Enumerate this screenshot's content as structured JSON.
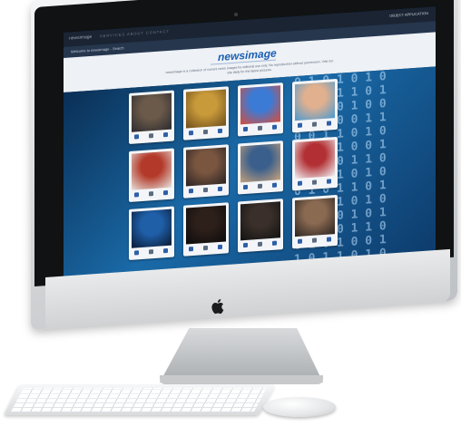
{
  "screen": {
    "topbar": {
      "brand": "newsimage",
      "nav": "SERVICES   ABOUT   CONTACT",
      "right_link": "OBJECT APPLICATION"
    },
    "breadcrumb": "Welcome to newsimage - Search",
    "hero": {
      "logo": "newsimage",
      "tagline": "newsimage is a collection of current news images for editorial use only. No reproduction without permission. Visit our site daily for the latest pictures."
    },
    "binary_pattern": "0 1 0 1 0 1 0\n1 0 0 1 1 0 1\n0 1 1 0 1 0 0\n1 0 1 0 0 1 1\n0 0 1 1 0 1 0\n1 1 0 1 0 0 1\n0 1 0 0 1 1 0\n1 0 1 1 0 1 0\n0 1 0 1 1 0 1\n1 0 0 1 0 1 0\n0 1 1 0 1 0 1\n1 0 1 0 1 1 0\n0 1 0 1 0 0 1\n1 0 1 1 0 1 0",
    "cards": [
      {
        "subject": "man-portrait",
        "color1": "#6b5a4a",
        "color2": "#2c2a2e"
      },
      {
        "subject": "bitcoin-coins",
        "color1": "#c99a3a",
        "color2": "#6e4e1b"
      },
      {
        "subject": "app-icons-phone",
        "color1": "#3b7bd6",
        "color2": "#d94c3a"
      },
      {
        "subject": "smiling-man",
        "color1": "#e1b08f",
        "color2": "#4a9ad0"
      },
      {
        "subject": "game-character",
        "color1": "#b33a2a",
        "color2": "#e6e2dc"
      },
      {
        "subject": "woman-portrait",
        "color1": "#7a5640",
        "color2": "#2a2222"
      },
      {
        "subject": "group-meeting",
        "color1": "#3a5f8c",
        "color2": "#c6a17a"
      },
      {
        "subject": "politician-speech",
        "color1": "#b23033",
        "color2": "#f0f2f5"
      },
      {
        "subject": "earth-from-space",
        "color1": "#1f5fa8",
        "color2": "#0b1a33"
      },
      {
        "subject": "dark-scene",
        "color1": "#2d1f1a",
        "color2": "#0b0b0b"
      },
      {
        "subject": "dark-portrait",
        "color1": "#3a2f2a",
        "color2": "#121212"
      },
      {
        "subject": "crowd",
        "color1": "#8b6a52",
        "color2": "#2a2420"
      }
    ]
  },
  "device": {
    "logo_icon": "apple-logo-icon",
    "accent": "#1a5fb4"
  }
}
